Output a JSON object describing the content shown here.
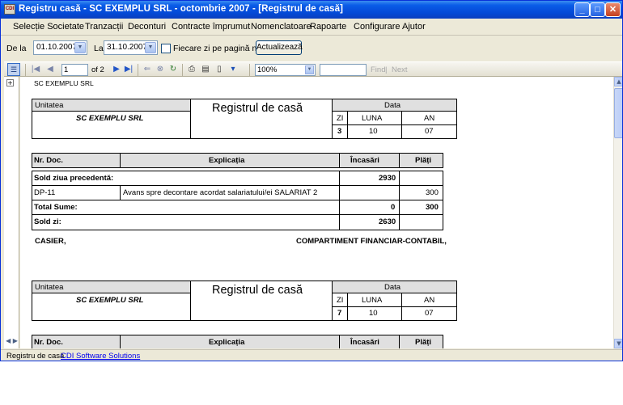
{
  "window": {
    "title": "Registru casă - SC EXEMPLU SRL - octombrie 2007 - [Registrul de casă]",
    "icon_label": "CDI",
    "min_glyph": "_",
    "max_glyph": "□",
    "close_glyph": "✕"
  },
  "menu": [
    "Selecție Societate",
    "Tranzacții",
    "Deconturi",
    "Contracte împrumut",
    "Nomenclatoare",
    "Rapoarte",
    "Configurare",
    "Ajutor"
  ],
  "filter": {
    "from_label": "De la",
    "from_value": "01.10.2007",
    "to_label": "La",
    "to_value": "31.10.2007",
    "checkbox_label": "Fiecare zi pe pagină nouă",
    "refresh_label": "Actualizează"
  },
  "toolbar": {
    "page_value": "1",
    "page_of": "of 2",
    "zoom_value": "100%",
    "find_label": "Find",
    "next_label": "Next",
    "separator": "|"
  },
  "report": {
    "company": "SC EXEMPLU SRL",
    "header_unit_label": "Unitatea",
    "header_unit_value": "SC EXEMPLU SRL",
    "title": "Registrul de casă",
    "data_label": "Data",
    "col_zi": "ZI",
    "col_luna": "LUNA",
    "col_an": "AN",
    "table_headers": [
      "Nr. Doc.",
      "Explicația",
      "Încasări",
      "Plăți"
    ],
    "day1": {
      "zi": "3",
      "luna": "10",
      "an": "07",
      "sold_precedenta_label": "Sold ziua precedentă:",
      "sold_precedenta_value": "2930",
      "row_doc": "DP-11",
      "row_expl": "Avans spre decontare acordat salariatului/ei SALARIAT 2",
      "row_plati": "300",
      "total_label": "Total Sume:",
      "total_incasari": "0",
      "total_plati": "300",
      "sold_zi_label": "Sold zi:",
      "sold_zi_value": "2630"
    },
    "signature_left": "CASIER,",
    "signature_right": "COMPARTIMENT FINANCIAR-CONTABIL,",
    "day2": {
      "zi": "7",
      "luna": "10",
      "an": "07"
    }
  },
  "status": {
    "text": "Registru de casă",
    "link": "CDI Software Solutions"
  }
}
